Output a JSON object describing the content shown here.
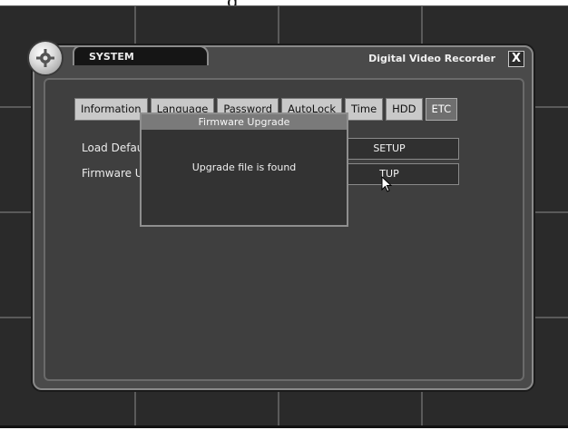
{
  "window": {
    "section_tab": "SYSTEM",
    "title": "Digital Video Recorder",
    "close_label": "X",
    "icons": {
      "settings": "gear-icon",
      "pointer": "mouse-pointer-icon"
    }
  },
  "tabs": [
    {
      "label": "Information",
      "active": false
    },
    {
      "label": "Language",
      "active": false
    },
    {
      "label": "Password",
      "active": false
    },
    {
      "label": "AutoLock",
      "active": false
    },
    {
      "label": "Time",
      "active": false
    },
    {
      "label": "HDD",
      "active": false
    },
    {
      "label": "ETC",
      "active": true
    }
  ],
  "settings": {
    "load_default": {
      "label": "Load Default",
      "button": "SETUP"
    },
    "firmware_upgrade": {
      "label": "Firmware Upgra",
      "button": "TUP"
    }
  },
  "dialog": {
    "title": "Firmware Upgrade",
    "message": "Upgrade file is found"
  }
}
